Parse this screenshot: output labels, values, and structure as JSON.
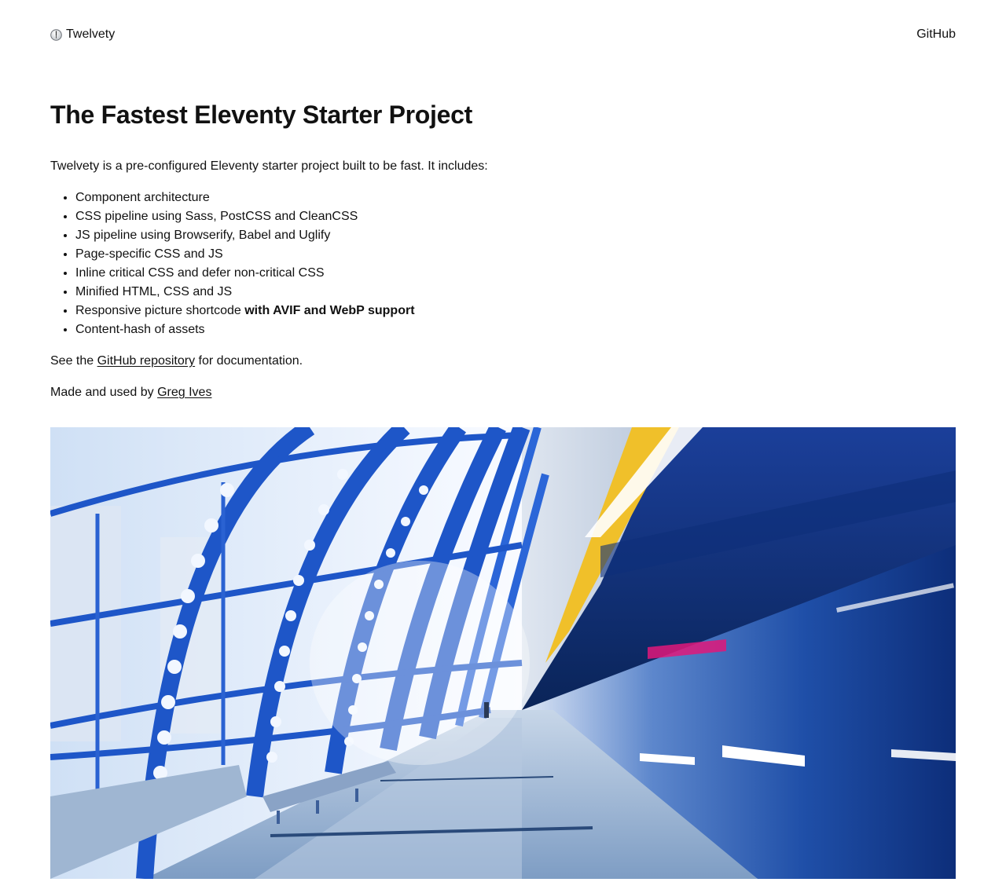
{
  "header": {
    "brand_label": "Twelvety",
    "brand_icon": "clock-icon",
    "nav_github": "GitHub"
  },
  "main": {
    "title": "The Fastest Eleventy Starter Project",
    "intro": "Twelvety is a pre-configured Eleventy starter project built to be fast. It includes:",
    "features": [
      "Component architecture",
      "CSS pipeline using Sass, PostCSS and CleanCSS",
      "JS pipeline using Browserify, Babel and Uglify",
      "Page-specific CSS and JS",
      "Inline critical CSS and defer non-critical CSS",
      "Minified HTML, CSS and JS"
    ],
    "feature_picture_prefix": "Responsive picture shortcode ",
    "feature_picture_bold": "with AVIF and WebP support",
    "feature_last": "Content-hash of assets",
    "docs_prefix": "See the ",
    "docs_link": "GitHub repository",
    "docs_suffix": " for documentation.",
    "credit_prefix": "Made and used by ",
    "credit_link": "Greg Ives"
  },
  "hero": {
    "subject": "metro-station-train-photo"
  },
  "colors": {
    "text": "#111111",
    "background": "#ffffff",
    "steel_blue": "#1e56c8",
    "deep_navy": "#0b2a6b"
  }
}
